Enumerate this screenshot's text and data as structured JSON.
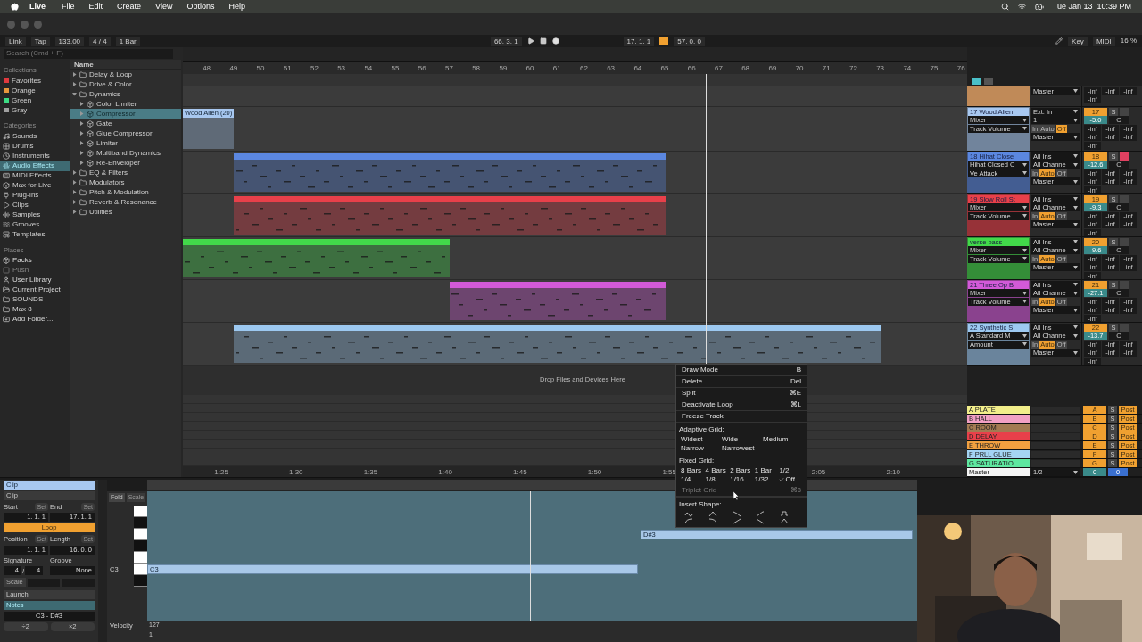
{
  "menubar": {
    "items": [
      "Live",
      "File",
      "Edit",
      "Create",
      "View",
      "Options",
      "Help"
    ],
    "date": "Tue Jan 13",
    "time": "10:39 PM"
  },
  "transport": {
    "link": "Link",
    "tap": "Tap",
    "tempo": "133.00",
    "signature": "4 / 4",
    "quantize": "1 Bar",
    "position": "66. 3. 1",
    "loop_start": "17. 1. 1",
    "loop_on": true,
    "loop_length": "57. 0. 0",
    "key": "Key",
    "midi": "MIDI",
    "cpu": "16 %"
  },
  "browser": {
    "search": {
      "placeholder": "Search (Cmd + F)"
    },
    "collections_heading": "Collections",
    "collections": [
      {
        "label": "Favorites",
        "color": "#e0393e"
      },
      {
        "label": "Orange",
        "color": "#e8963c"
      },
      {
        "label": "Green",
        "color": "#3ddc84"
      },
      {
        "label": "Gray",
        "color": "#a0a0a0"
      }
    ],
    "categories_heading": "Categories",
    "categories": [
      {
        "label": "Sounds",
        "selected": false
      },
      {
        "label": "Drums",
        "selected": false
      },
      {
        "label": "Instruments",
        "selected": false
      },
      {
        "label": "Audio Effects",
        "selected": true
      },
      {
        "label": "MIDI Effects",
        "selected": false
      },
      {
        "label": "Max for Live",
        "selected": false
      },
      {
        "label": "Plug-Ins",
        "selected": false
      },
      {
        "label": "Clips",
        "selected": false
      },
      {
        "label": "Samples",
        "selected": false
      },
      {
        "label": "Grooves",
        "selected": false
      },
      {
        "label": "Templates",
        "selected": false
      }
    ],
    "places_heading": "Places",
    "places": [
      {
        "label": "Packs",
        "disabled": false
      },
      {
        "label": "Push",
        "disabled": true
      },
      {
        "label": "User Library",
        "disabled": false
      },
      {
        "label": "Current Project",
        "disabled": false
      },
      {
        "label": "SOUNDS",
        "disabled": false
      },
      {
        "label": "Max 8",
        "disabled": false
      },
      {
        "label": "Add Folder...",
        "disabled": false
      }
    ],
    "name_heading": "Name",
    "tree": [
      {
        "label": "Delay & Loop",
        "expanded": false,
        "selected": false
      },
      {
        "label": "Drive & Color",
        "expanded": false,
        "selected": false
      },
      {
        "label": "Dynamics",
        "expanded": true,
        "selected": false,
        "children": [
          {
            "label": "Color Limiter",
            "expanded": false,
            "selected": false
          },
          {
            "label": "Compressor",
            "expanded": false,
            "selected": true
          },
          {
            "label": "Gate",
            "expanded": false,
            "selected": false
          },
          {
            "label": "Glue Compressor",
            "expanded": false,
            "selected": false
          },
          {
            "label": "Limiter",
            "expanded": false,
            "selected": false
          },
          {
            "label": "Multiband Dynamics",
            "expanded": false,
            "selected": false
          },
          {
            "label": "Re-Enveloper",
            "expanded": false,
            "selected": false
          }
        ]
      },
      {
        "label": "EQ & Filters",
        "expanded": false,
        "selected": false
      },
      {
        "label": "Modulators",
        "expanded": false,
        "selected": false
      },
      {
        "label": "Pitch & Modulation",
        "expanded": false,
        "selected": false
      },
      {
        "label": "Reverb & Resonance",
        "expanded": false,
        "selected": false
      },
      {
        "label": "Utilities",
        "expanded": false,
        "selected": false
      }
    ]
  },
  "arrangement": {
    "bars": [
      "48",
      "49",
      "50",
      "51",
      "52",
      "53",
      "54",
      "55",
      "56",
      "57",
      "58",
      "59",
      "60",
      "61",
      "62",
      "63",
      "64",
      "65",
      "66",
      "67",
      "68",
      "69",
      "70",
      "71",
      "72",
      "73",
      "74",
      "75",
      "76"
    ],
    "time_ruler": [
      "1:25",
      "1:30",
      "1:35",
      "1:40",
      "1:45",
      "1:50",
      "1:55",
      "2:05",
      "2:10"
    ],
    "drop_hint": "Drop Files and Devices Here"
  },
  "tracks": [
    {
      "color": "#c08a58",
      "output": "Master",
      "sends": [
        "-inf",
        "-inf",
        "-inf",
        "-inf"
      ]
    },
    {
      "name": "17 Wood Alien",
      "color": "#a8c8f0",
      "clips": [
        {
          "label": "Wood Alien (20)"
        }
      ],
      "device": "Mixer",
      "param": "Track Volume",
      "input": "Ext. In",
      "channel": "1",
      "monitor": [
        {
          "label": "In",
          "selected": false
        },
        {
          "label": "Auto",
          "selected": false
        },
        {
          "label": "Off",
          "selected": true
        }
      ],
      "output": "Master",
      "number": "17",
      "solo": "S",
      "armed": false,
      "volume": "-5.0",
      "pan": "C",
      "sends": [
        "-inf",
        "-inf",
        "-inf",
        "-inf",
        "-inf",
        "-inf",
        "-inf"
      ]
    },
    {
      "name": "18 Hihat Close",
      "color": "#5b87e0",
      "clips": [
        {
          "kind": "midi"
        }
      ],
      "device": "Hihat Closed C",
      "param": "Ve Attack",
      "input": "All Ins",
      "channel": "All Channe",
      "monitor": [
        {
          "label": "In",
          "selected": false
        },
        {
          "label": "Auto",
          "selected": true
        },
        {
          "label": "Off",
          "selected": false
        }
      ],
      "output": "Master",
      "number": "18",
      "solo": "S",
      "armed": true,
      "volume": "-12.6",
      "pan": "C",
      "sends": [
        "-inf",
        "-inf",
        "-inf",
        "-inf",
        "-inf",
        "-inf",
        "-inf"
      ]
    },
    {
      "name": "19 Slow Roll St",
      "color": "#e8404a",
      "clips": [
        {
          "kind": "midi"
        }
      ],
      "device": "Mixer",
      "param": "Track Volume",
      "input": "All Ins",
      "channel": "All Channe",
      "monitor": [
        {
          "label": "In",
          "selected": false
        },
        {
          "label": "Auto",
          "selected": true
        },
        {
          "label": "Off",
          "selected": false
        }
      ],
      "output": "Master",
      "number": "19",
      "solo": "S",
      "armed": false,
      "volume": "-9.3",
      "pan": "C",
      "sends": [
        "-inf",
        "-inf",
        "-inf",
        "-inf",
        "-inf",
        "-inf",
        "-inf"
      ]
    },
    {
      "name": "verse bass",
      "color": "#42d94a",
      "clips": [
        {
          "kind": "midi"
        }
      ],
      "device": "Mixer",
      "param": "Track Volume",
      "input": "All Ins",
      "channel": "All Channe",
      "monitor": [
        {
          "label": "In",
          "selected": false
        },
        {
          "label": "Auto",
          "selected": true
        },
        {
          "label": "Off",
          "selected": false
        }
      ],
      "output": "Master",
      "number": "20",
      "solo": "S",
      "armed": false,
      "volume": "-9.6",
      "pan": "C",
      "sends": [
        "-inf",
        "-inf",
        "-inf",
        "-inf",
        "-inf",
        "-inf",
        "-inf"
      ]
    },
    {
      "name": "21 Three Op B",
      "color": "#d25ad8",
      "clips": [
        {
          "kind": "midi"
        }
      ],
      "device": "Mixer",
      "param": "Track Volume",
      "input": "All Ins",
      "channel": "All Channe",
      "monitor": [
        {
          "label": "In",
          "selected": false
        },
        {
          "label": "Auto",
          "selected": true
        },
        {
          "label": "Off",
          "selected": false
        }
      ],
      "output": "Master",
      "number": "21",
      "solo": "S",
      "armed": false,
      "volume": "-27.1",
      "pan": "C",
      "sends": [
        "-inf",
        "-inf",
        "-inf",
        "-inf",
        "-inf",
        "-inf",
        "-inf"
      ]
    },
    {
      "name": "22 Synthetic S",
      "color": "#9cc8f0",
      "clips": [
        {
          "kind": "midi"
        }
      ],
      "device": "A Standard M",
      "param": "Amount",
      "input": "All Ins",
      "channel": "All Channe",
      "monitor": [
        {
          "label": "In",
          "selected": false
        },
        {
          "label": "Auto",
          "selected": true
        },
        {
          "label": "Off",
          "selected": false
        }
      ],
      "output": "Master",
      "number": "22",
      "solo": "S",
      "armed": false,
      "volume": "-13.7",
      "pan": "C",
      "sends": [
        "-inf",
        "-inf",
        "-inf",
        "-inf",
        "-inf",
        "-inf",
        "-inf"
      ]
    }
  ],
  "mixer_toggles": [
    {
      "on": true
    },
    {
      "on": false
    }
  ],
  "returns": [
    {
      "kind": "return",
      "name": "A PLATE",
      "color": "#f2ee8a",
      "letter": "A",
      "solo": "S",
      "mode": "Post"
    },
    {
      "kind": "return",
      "name": "B HALL",
      "color": "#f2a0c4",
      "letter": "B",
      "solo": "S",
      "mode": "Post"
    },
    {
      "kind": "return",
      "name": "C ROOM",
      "color": "#a37a52",
      "letter": "C",
      "solo": "S",
      "mode": "Post"
    },
    {
      "kind": "return",
      "name": "D DELAY",
      "color": "#e8404a",
      "letter": "D",
      "solo": "S",
      "mode": "Post"
    },
    {
      "kind": "return",
      "name": "E THROW",
      "color": "#f2a040",
      "letter": "E",
      "solo": "S",
      "mode": "Post"
    },
    {
      "kind": "return",
      "name": "F PRLL GLUE",
      "color": "#a4d4f4",
      "letter": "F",
      "solo": "S",
      "mode": "Post"
    },
    {
      "kind": "return",
      "name": "G SATURATIO",
      "color": "#5ee8a0",
      "letter": "G",
      "solo": "S",
      "mode": "Post"
    },
    {
      "kind": "master",
      "name": "Master",
      "color": "#f4f4f4",
      "output": "1/2",
      "volume": "0",
      "pan": "0"
    }
  ],
  "context_menu": {
    "items": [
      {
        "kind": "command",
        "label": "Draw Mode",
        "shortcut": "B",
        "disabled": false
      },
      {
        "kind": "command",
        "label": "Delete",
        "shortcut": "Del",
        "disabled": false
      },
      {
        "kind": "command",
        "label": "Split",
        "shortcut": "⌘E",
        "disabled": false
      },
      {
        "kind": "command",
        "label": "Deactivate Loop",
        "shortcut": "⌘L",
        "disabled": false
      },
      {
        "kind": "command",
        "label": "Freeze Track",
        "disabled": false
      },
      {
        "kind": "grid",
        "label": "Adaptive Grid:",
        "options": [
          {
            "label": "Widest",
            "checked": false
          },
          {
            "label": "Wide",
            "checked": false
          },
          {
            "label": "Medium",
            "checked": false
          },
          {
            "label": "Narrow",
            "checked": false
          },
          {
            "label": "Narrowest",
            "checked": false
          }
        ]
      },
      {
        "kind": "grid",
        "label": "Fixed Grid:",
        "options": [
          {
            "label": "8 Bars",
            "checked": false
          },
          {
            "label": "4 Bars",
            "checked": false
          },
          {
            "label": "2 Bars",
            "checked": false
          },
          {
            "label": "1 Bar",
            "checked": false
          },
          {
            "label": "1/2",
            "checked": false
          },
          {
            "label": "1/4",
            "checked": false
          },
          {
            "label": "1/8",
            "checked": false
          },
          {
            "label": "1/16",
            "checked": false
          },
          {
            "label": "1/32",
            "checked": false
          },
          {
            "label": "Off",
            "checked": true
          }
        ]
      },
      {
        "kind": "command",
        "label": "Triplet Grid",
        "shortcut": "⌘3",
        "disabled": true
      },
      {
        "kind": "shapes",
        "label": "Insert Shape:"
      }
    ]
  },
  "clip_view": {
    "tab": "Clip",
    "section": "Clip",
    "start_label": "Start",
    "start_set": "Set",
    "start": "1. 1. 1",
    "end_label": "End",
    "end_set": "Set",
    "end": "17. 1. 1",
    "loop": {
      "label": "Loop",
      "on": true
    },
    "position_label": "Position",
    "position_set": "Set",
    "position": "1. 1. 1",
    "length_label": "Length",
    "length_set": "Set",
    "length": "16. 0. 0",
    "signature_label": "Signature",
    "groove_label": "Groove",
    "sig_num": "4",
    "sig_slash": "/",
    "sig_den": "4",
    "groove": "None",
    "scale": "Scale",
    "launch": "Launch",
    "notes": "Notes",
    "range": "C3 - D#3",
    "halve": "÷2",
    "double": "×2"
  },
  "piano_roll": {
    "fold": "Fold",
    "scale": "Scale",
    "key_label": "C3",
    "velocity": "Velocity",
    "vel_max": "127",
    "vel_min": "1",
    "notes": [
      {
        "label": "C3"
      },
      {
        "label": "D#3"
      }
    ]
  }
}
